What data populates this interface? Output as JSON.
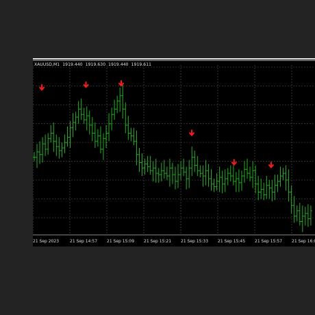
{
  "chart_header": {
    "symbol": "XAUUSD,M1",
    "open": "1919.440",
    "high": "1919.630",
    "low": "1919.440",
    "close": "1919.611"
  },
  "colors": {
    "page_bg": "#232323",
    "chart_bg": "#000000",
    "grid": "#5a5a5a",
    "bar": "#1fb51f",
    "signal": "#ff1a1a",
    "text": "#e6e6e6"
  },
  "time_axis": {
    "labels": [
      "21 Sep 2023",
      "21 Sep 14:57",
      "21 Sep 15:09",
      "21 Sep 15:21",
      "21 Sep 15:33",
      "21 Sep 15:45",
      "21 Sep 15:57",
      "21 Sep 16:09"
    ]
  },
  "chart_data": {
    "type": "ohlc",
    "bar_style": "open-close bars",
    "grid": true,
    "title": "",
    "price_range": [
      0,
      100
    ],
    "closes": [
      38,
      42,
      40,
      48,
      44,
      52,
      56,
      50,
      46,
      43,
      45,
      49,
      53,
      60,
      64,
      68,
      74,
      70,
      66,
      69,
      62,
      56,
      50,
      54,
      44,
      52,
      56,
      63,
      70,
      74,
      80,
      84,
      74,
      62,
      56,
      54,
      50,
      40,
      34,
      30,
      33,
      31,
      28,
      30,
      26,
      25,
      28,
      26,
      24,
      30,
      25,
      20,
      25,
      30,
      27,
      22,
      30,
      38,
      32,
      28,
      26,
      24,
      28,
      22,
      18,
      16,
      20,
      23,
      18,
      22,
      26,
      24,
      20,
      22,
      19,
      24,
      29,
      26,
      23,
      28,
      18,
      12,
      14,
      10,
      17,
      15,
      12,
      17,
      20,
      24,
      26,
      21,
      12,
      2,
      -6,
      -2,
      -10,
      -6,
      -4,
      -8,
      -2
    ],
    "signals_down": [
      {
        "bar": 2,
        "price": 90
      },
      {
        "bar": 27,
        "price": 92
      },
      {
        "bar": 47,
        "price": 93
      },
      {
        "bar": 87,
        "price": 56
      },
      {
        "bar": 111,
        "price": 34
      },
      {
        "bar": 132,
        "price": 32
      }
    ]
  }
}
